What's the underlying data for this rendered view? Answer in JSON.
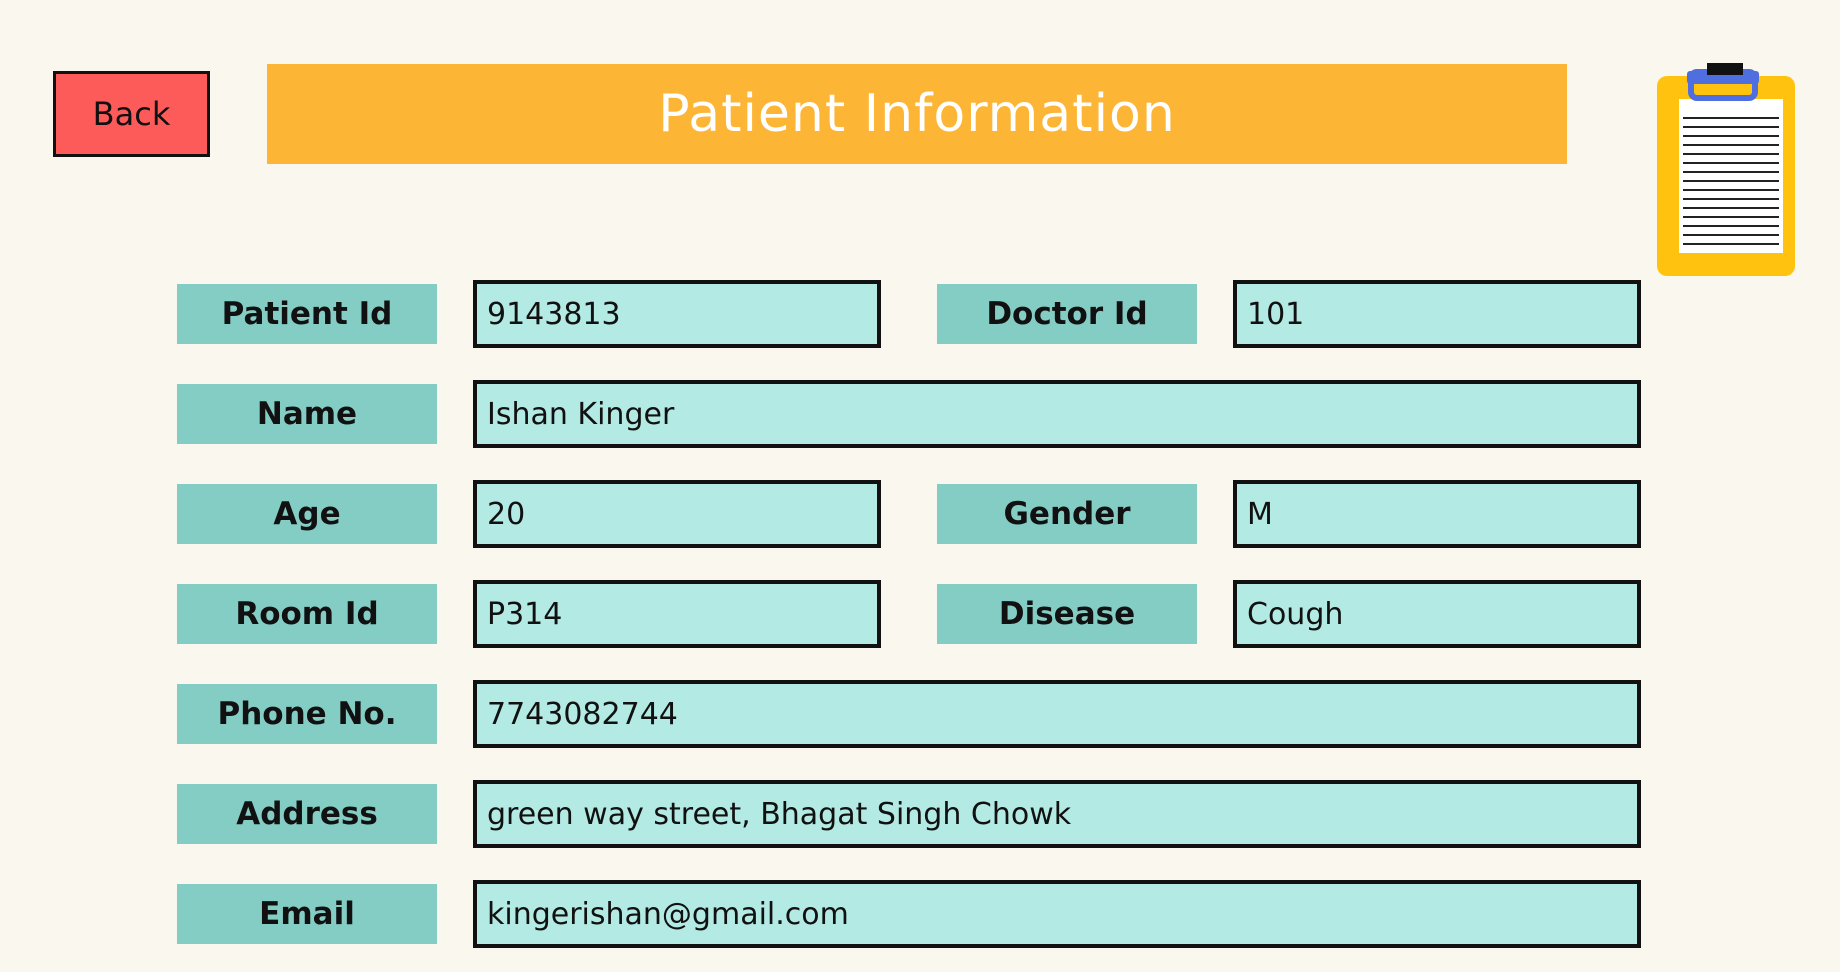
{
  "header": {
    "back_label": "Back",
    "title": "Patient Information"
  },
  "icons": {
    "clipboard": "clipboard-icon"
  },
  "colors": {
    "background": "#faf7ef",
    "back_button": "#fd5a5a",
    "title_bar": "#fdb535",
    "label_bg": "#84cdc5",
    "field_bg": "#b3eae4"
  },
  "form": {
    "patient_id": {
      "label": "Patient Id",
      "value": "9143813"
    },
    "doctor_id": {
      "label": "Doctor Id",
      "value": "101"
    },
    "name": {
      "label": "Name",
      "value": "Ishan Kinger"
    },
    "age": {
      "label": "Age",
      "value": "20"
    },
    "gender": {
      "label": "Gender",
      "value": "M"
    },
    "room_id": {
      "label": "Room Id",
      "value": "P314"
    },
    "disease": {
      "label": "Disease",
      "value": "Cough"
    },
    "phone": {
      "label": "Phone No.",
      "value": "7743082744"
    },
    "address": {
      "label": "Address",
      "value": "green way street, Bhagat Singh Chowk"
    },
    "email": {
      "label": "Email",
      "value": "kingerishan@gmail.com"
    }
  }
}
